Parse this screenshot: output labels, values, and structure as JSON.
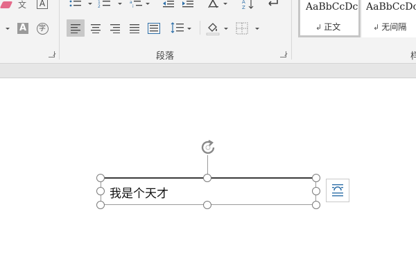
{
  "ribbon": {
    "paragraph_group_label": "段落",
    "right_group_label_partial": "样",
    "styles": [
      {
        "sample": "AaBbCcDc",
        "name": "正文",
        "selected": true
      },
      {
        "sample": "AaBbCcDc",
        "name": "无间隔",
        "selected": false
      }
    ],
    "font_buttons": {
      "phonetic_glyph": "文",
      "border_char_glyph": "A",
      "shade_char_glyph": "A",
      "enclose_char_glyph": "字"
    },
    "paragraph_mark_glyph": "↲"
  },
  "document": {
    "textbox_text": "我是个天才"
  },
  "colors": {
    "ribbon_bg": "#f3f3f3",
    "strip_bg": "#e6e6e6",
    "selected_align_bg": "#c8c8c8",
    "eraser_pink": "#e46a8a",
    "layout_icon_blue": "#2e6fa8"
  }
}
